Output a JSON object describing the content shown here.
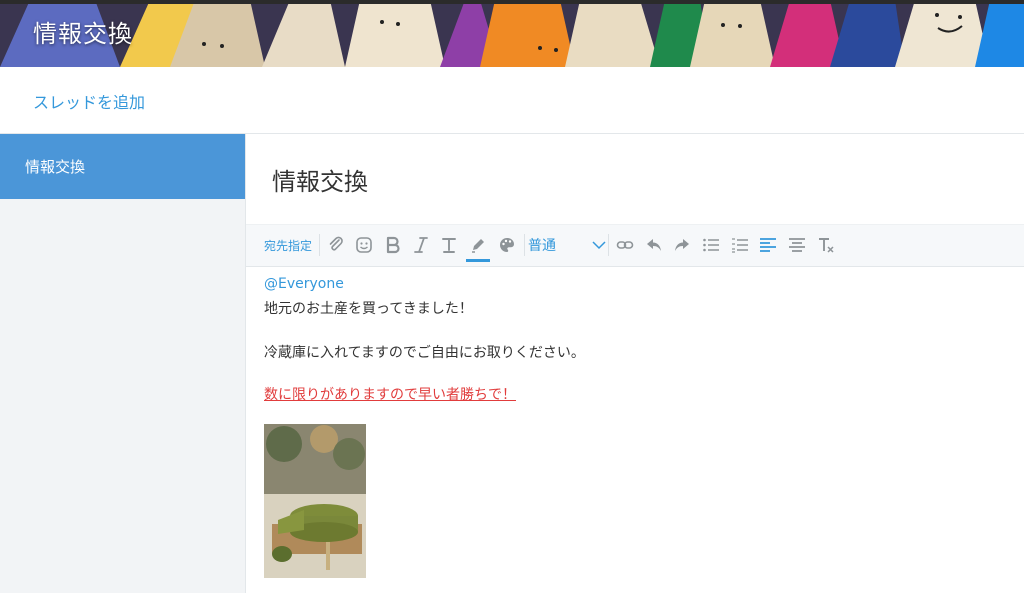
{
  "header": {
    "title": "情報交換",
    "banner_image": "colored-pencils-banner"
  },
  "actions": {
    "add_thread": "スレッドを追加"
  },
  "sidebar": {
    "items": [
      {
        "label": "情報交換",
        "selected": true
      }
    ]
  },
  "main": {
    "title": "情報交換",
    "toolbar": {
      "mention_label": "宛先指定",
      "format_value": "普通",
      "icons": [
        "attach-icon",
        "emoji-icon",
        "bold-icon",
        "italic-icon",
        "text-size-icon",
        "highlight-pen-icon",
        "color-palette-icon",
        "link-icon",
        "undo-icon",
        "redo-icon",
        "bullet-list-icon",
        "numbered-list-icon",
        "align-left-icon",
        "align-center-icon",
        "clear-format-icon"
      ]
    },
    "editor": {
      "mention": "@Everyone",
      "line1": "地元のお土産を買ってきました！",
      "line2": "冷蔵庫に入れてますのでご自由にお取りください。",
      "line3": "数に限りがありますので早い者勝ちで！",
      "line3_color": "#e13c3c",
      "image": "matcha-cake-photo"
    }
  },
  "colors": {
    "accent": "#3498db",
    "sidebar_selected": "#4b96d8",
    "sidebar_bg": "#f2f4f6"
  }
}
